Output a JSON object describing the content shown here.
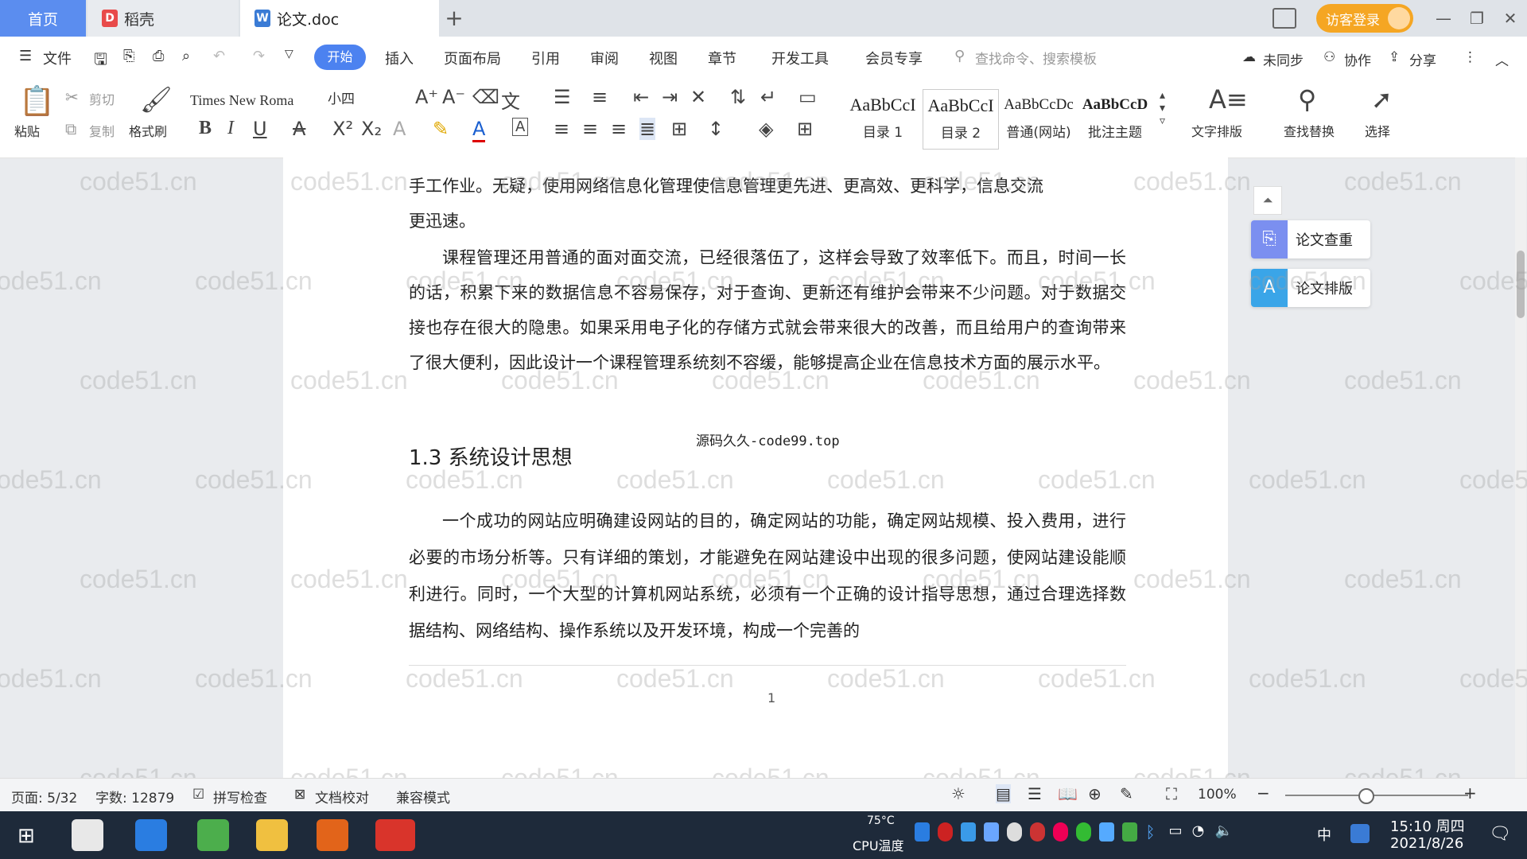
{
  "tabs": {
    "home": "首页",
    "docer": "稻壳",
    "doc": "论文.doc",
    "add": "+"
  },
  "titlebar": {
    "login": "访客登录"
  },
  "menu": {
    "file": "文件",
    "items": [
      "开始",
      "插入",
      "页面布局",
      "引用",
      "审阅",
      "视图",
      "章节",
      "开发工具",
      "会员专享"
    ],
    "search": "查找命令、搜索模板",
    "sync": "未同步",
    "collab": "协作",
    "share": "分享"
  },
  "ribbon": {
    "paste": "粘贴",
    "cut": "剪切",
    "copy": "复制",
    "format_painter": "格式刷",
    "font_name": "Times New Roma",
    "font_size": "小四",
    "styles": [
      {
        "preview": "AaBbCcI",
        "name": "目录 1"
      },
      {
        "preview": "AaBbCcI",
        "name": "目录 2"
      },
      {
        "preview": "AaBbCcDc",
        "name": "普通(网站)"
      },
      {
        "preview": "AaBbCcD",
        "name": "批注主题"
      }
    ],
    "text_layout": "文字排版",
    "find_replace": "查找替换",
    "select": "选择"
  },
  "document": {
    "para1_line1": "手工作业。无疑，使用网络信息化管理使信息管理更先进、更高效、更科学，信息交流",
    "para1_line2": "更迅速。",
    "para2": "课程管理还用普通的面对面交流，已经很落伍了，这样会导致了效率低下。而且，时间一长的话，积累下来的数据信息不容易保存，对于查询、更新还有维护会带来不少问题。对于数据交接也存在很大的隐患。如果采用电子化的存储方式就会带来很大的改善，而且给用户的查询带来了很大便利，因此设计一个课程管理系统刻不容缓，能够提高企业在信息技术方面的展示水平。",
    "source_note": "源码久久-code99.top",
    "heading": "1.3 系统设计思想",
    "para3": "一个成功的网站应明确建设网站的目的，确定网站的功能，确定网站规模、投入费用，进行必要的市场分析等。只有详细的策划，才能避免在网站建设中出现的很多问题，使网站建设能顺利进行。同时，一个大型的计算机网站系统，必须有一个正确的设计指导思想，通过合理选择数据结构、网络结构、操作系统以及开发环境，构成一个完善的",
    "page_number": "1"
  },
  "side_panel": {
    "check": "论文查重",
    "layout": "论文排版"
  },
  "watermark": "code51.cn",
  "status": {
    "page": "页面: 5/32",
    "words": "字数: 12879",
    "spell": "拼写检查",
    "proof": "文档校对",
    "compat": "兼容模式",
    "zoom": "100%"
  },
  "taskbar": {
    "cpu_temp": "75°C",
    "cpu_label": "CPU温度",
    "time": "15:10 周四",
    "date": "2021/8/26",
    "ime": "中"
  },
  "colors": {
    "accent": "#4c82f0",
    "login": "#f5a623",
    "taskbar": "#1e2a3a"
  }
}
